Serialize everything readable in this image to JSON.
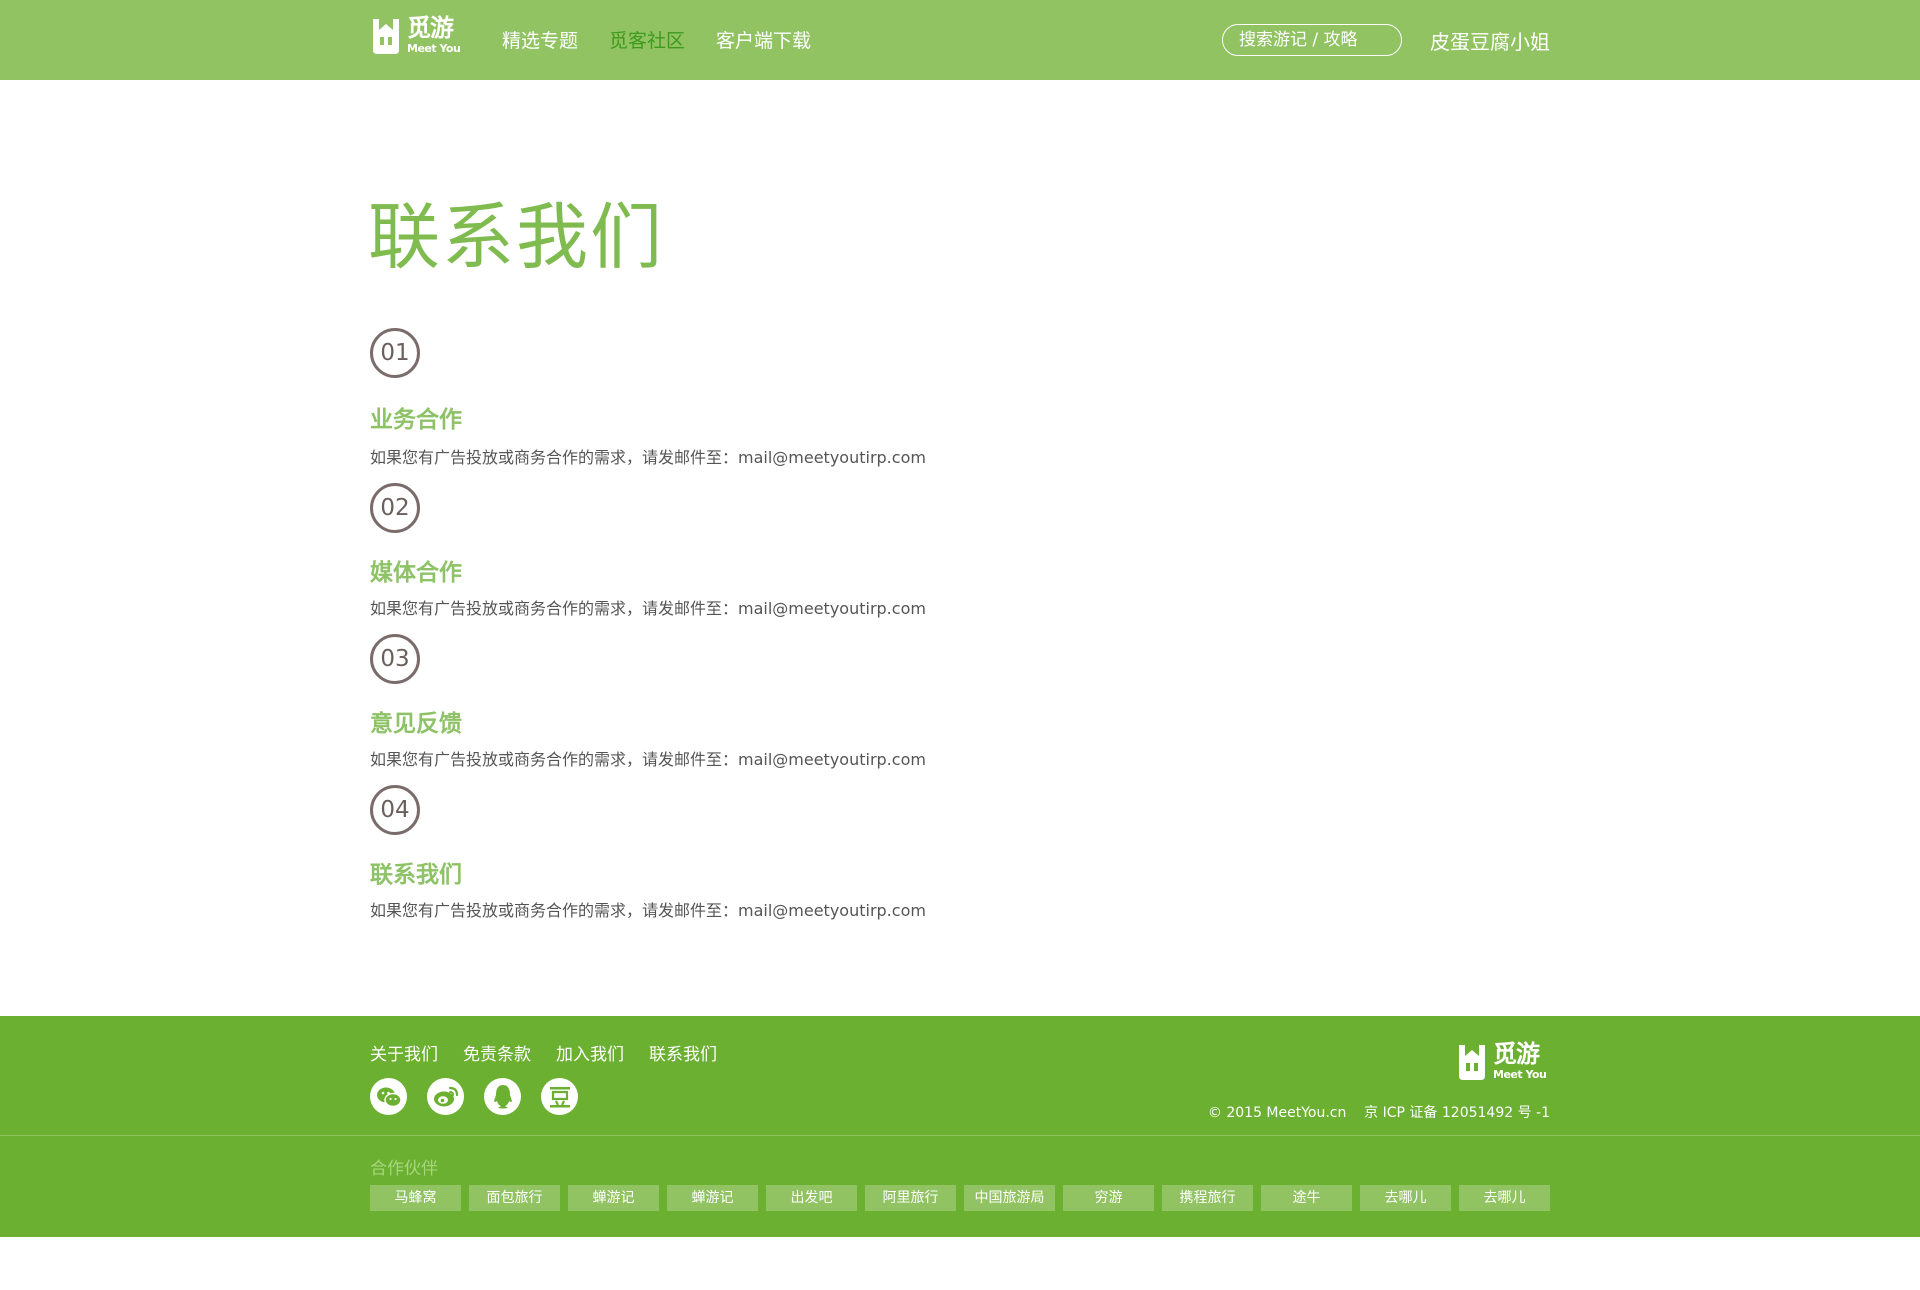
{
  "header": {
    "logo_cn": "觅游",
    "logo_en": "Meet You",
    "nav": [
      {
        "label": "精选专题",
        "active": false
      },
      {
        "label": "觅客社区",
        "active": true
      },
      {
        "label": "客户端下载",
        "active": false
      }
    ],
    "search_placeholder": "搜索游记 / 攻略",
    "username": "皮蛋豆腐小姐"
  },
  "main": {
    "title": "联系我们",
    "sections": [
      {
        "num": "01",
        "title": "业务合作",
        "text": "如果您有广告投放或商务合作的需求，请发邮件至：mail@meetyoutirp.com"
      },
      {
        "num": "02",
        "title": "媒体合作",
        "text": "如果您有广告投放或商务合作的需求，请发邮件至：mail@meetyoutirp.com"
      },
      {
        "num": "03",
        "title": "意见反馈",
        "text": "如果您有广告投放或商务合作的需求，请发邮件至：mail@meetyoutirp.com"
      },
      {
        "num": "04",
        "title": "联系我们",
        "text": "如果您有广告投放或商务合作的需求，请发邮件至：mail@meetyoutirp.com"
      }
    ]
  },
  "footer": {
    "links": [
      "关于我们",
      "免责条款",
      "加入我们",
      "联系我们"
    ],
    "socials": [
      "wechat-icon",
      "weibo-icon",
      "qq-icon",
      "douban-icon"
    ],
    "logo_cn": "觅游",
    "logo_en": "Meet You",
    "copyright": "© 2015 MeetYou.cn    京 ICP 证备 12051492 号 -1",
    "partners_label": "合作伙伴",
    "partners": [
      "马蜂窝",
      "面包旅行",
      "蝉游记",
      "蝉游记",
      "出发吧",
      "阿里旅行",
      "中国旅游局",
      "穷游",
      "携程旅行",
      "途牛",
      "去哪儿",
      "去哪儿"
    ]
  },
  "colors": {
    "header_bg": "#92c363",
    "accent": "#7fbb4f",
    "footer_bg": "#6bb030",
    "partner_bg": "#92c363"
  }
}
